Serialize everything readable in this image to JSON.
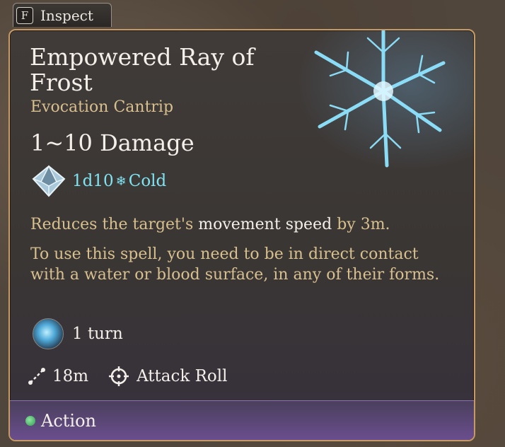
{
  "inspect": {
    "key": "F",
    "label": "Inspect"
  },
  "spell": {
    "name": "Empowered Ray of Frost",
    "school_level": "Evocation Cantrip",
    "damage_heading": "1~10 Damage",
    "damage_dice": "1d10",
    "damage_type": "Cold",
    "description_pre": "Reduces the target's",
    "description_highlight": "movement speed",
    "description_post": "by 3m.",
    "requirement": "To use this spell, you need to be in direct contact with a water or blood surface, in any of their forms.",
    "duration": "1 turn",
    "range": "18m",
    "roll": "Attack Roll",
    "cost": "Action"
  },
  "icons": {
    "key": "keyboard-f-key",
    "die": "d10-die-icon",
    "damage_type": "snowflake-icon",
    "duration": "frost-status-icon",
    "range": "range-line-icon",
    "roll": "crosshair-icon",
    "cost": "action-dot-icon"
  },
  "colors": {
    "border": "#c79a63",
    "heading": "#f4efe9",
    "body": "#d8c08e",
    "cold": "#7fe3f2",
    "action": "#3fa35e",
    "footer": "#6a4e8e"
  }
}
